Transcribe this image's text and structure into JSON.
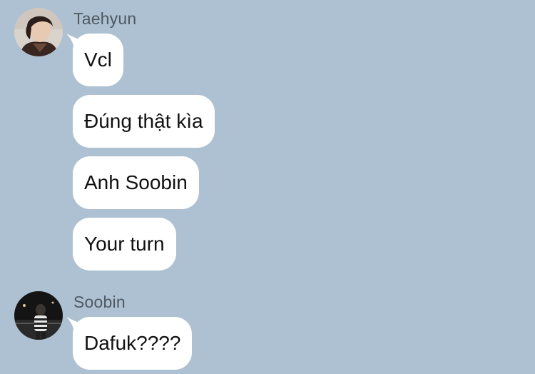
{
  "colors": {
    "background": "#aec1d2",
    "bubble": "#ffffff",
    "message_text": "#111111",
    "sender_name": "#4f5963"
  },
  "conversation": [
    {
      "sender": "Taehyun",
      "avatar": "avatar-photo-icon",
      "messages": [
        "Vcl",
        "Đúng thật kìa",
        "Anh Soobin",
        "Your turn"
      ]
    },
    {
      "sender": "Soobin",
      "avatar": "avatar-photo-icon",
      "messages": [
        "Dafuk????"
      ]
    }
  ]
}
